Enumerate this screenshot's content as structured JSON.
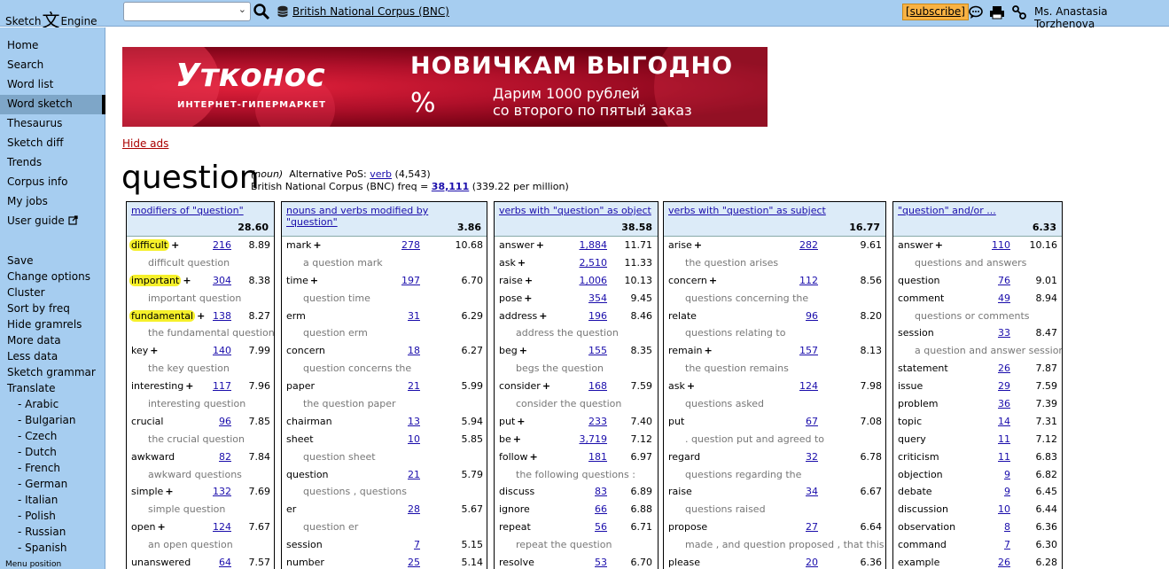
{
  "app": {
    "logo_left": "Sketch",
    "logo_glyph": "文",
    "logo_right": "Engine"
  },
  "topbar": {
    "search_value": "",
    "corpus": "British National Corpus (BNC)",
    "subscribe": "[subscribe]",
    "user": "Ms. Anastasia Torzhenova"
  },
  "sidebar": {
    "items": [
      "Home",
      "Search",
      "Word list",
      "Word sketch",
      "Thesaurus",
      "Sketch diff",
      "Trends",
      "Corpus info",
      "My jobs",
      "User guide"
    ],
    "actions": [
      "Save",
      "Change options",
      "Cluster",
      "Sort by freq",
      "Hide gramrels",
      "More data",
      "Less data",
      "Sketch grammar",
      "Translate"
    ],
    "languages": [
      "- Arabic",
      "- Bulgarian",
      "- Czech",
      "- Dutch",
      "- French",
      "- German",
      "- Italian",
      "- Polish",
      "- Russian",
      "- Spanish"
    ],
    "footer": "Menu position",
    "active": "Word sketch"
  },
  "ad": {
    "brand": "Утконос",
    "brand_sub": "ИНТЕРНЕТ-ГИПЕРМАРКЕТ",
    "headline": "НОВИЧКАМ ВЫГОДНО",
    "percent": "%",
    "line1": "Дарим 1000 рублей",
    "line2": "со второго по пятый заказ",
    "hide": "Hide ads"
  },
  "headword": {
    "word": "question",
    "pos": "(noun)",
    "alt_pos_label": "Alternative PoS:",
    "alt_pos": "verb",
    "alt_pos_count": "(4,543)",
    "corpus_freq_label": "British National Corpus (BNC) freq =",
    "freq": "38,111",
    "per_million": "(339.22 per million)"
  },
  "tables": [
    {
      "title": "modifiers of \"question\"",
      "score": "28.60",
      "rows": [
        {
          "word": "difficult",
          "plus": true,
          "freq": "216",
          "score": "8.89",
          "hl": true
        },
        {
          "example": "difficult question"
        },
        {
          "word": "important",
          "plus": true,
          "freq": "304",
          "score": "8.38",
          "hl": true
        },
        {
          "example": "important question"
        },
        {
          "word": "fundamental",
          "plus": true,
          "freq": "138",
          "score": "8.27",
          "hl": true
        },
        {
          "example": "the fundamental question"
        },
        {
          "word": "key",
          "plus": true,
          "freq": "140",
          "score": "7.99"
        },
        {
          "example": "the key question"
        },
        {
          "word": "interesting",
          "plus": true,
          "freq": "117",
          "score": "7.96"
        },
        {
          "example": "interesting question"
        },
        {
          "word": "crucial",
          "plus": false,
          "freq": "96",
          "score": "7.85"
        },
        {
          "example": "the crucial question"
        },
        {
          "word": "awkward",
          "plus": false,
          "freq": "82",
          "score": "7.84"
        },
        {
          "example": "awkward questions"
        },
        {
          "word": "simple",
          "plus": true,
          "freq": "132",
          "score": "7.69"
        },
        {
          "example": "simple question"
        },
        {
          "word": "open",
          "plus": true,
          "freq": "124",
          "score": "7.67"
        },
        {
          "example": "an open question"
        },
        {
          "word": "unanswered",
          "plus": false,
          "freq": "64",
          "score": "7.57"
        }
      ]
    },
    {
      "title": "nouns and verbs modified by \"question\"",
      "score": "3.86",
      "rows": [
        {
          "word": "mark",
          "plus": true,
          "freq": "278",
          "score": "10.68"
        },
        {
          "example": "a question mark"
        },
        {
          "word": "time",
          "plus": true,
          "freq": "197",
          "score": "6.70"
        },
        {
          "example": "question time"
        },
        {
          "word": "erm",
          "plus": false,
          "freq": "31",
          "score": "6.29"
        },
        {
          "example": "question erm"
        },
        {
          "word": "concern",
          "plus": false,
          "freq": "18",
          "score": "6.27"
        },
        {
          "example": "question concerns the"
        },
        {
          "word": "paper",
          "plus": false,
          "freq": "21",
          "score": "5.99"
        },
        {
          "example": "the question paper"
        },
        {
          "word": "chairman",
          "plus": false,
          "freq": "13",
          "score": "5.94"
        },
        {
          "word": "sheet",
          "plus": false,
          "freq": "10",
          "score": "5.85"
        },
        {
          "example": "question sheet"
        },
        {
          "word": "question",
          "plus": false,
          "freq": "21",
          "score": "5.79"
        },
        {
          "example": "questions , questions"
        },
        {
          "word": "er",
          "plus": false,
          "freq": "28",
          "score": "5.67"
        },
        {
          "example": "question er"
        },
        {
          "word": "session",
          "plus": false,
          "freq": "7",
          "score": "5.15"
        },
        {
          "word": "number",
          "plus": false,
          "freq": "25",
          "score": "5.14"
        }
      ]
    },
    {
      "title": "verbs with \"question\" as object",
      "score": "38.58",
      "rows": [
        {
          "word": "answer",
          "plus": true,
          "freq": "1,884",
          "score": "11.71"
        },
        {
          "word": "ask",
          "plus": true,
          "freq": "2,510",
          "score": "11.33"
        },
        {
          "word": "raise",
          "plus": true,
          "freq": "1,006",
          "score": "10.13"
        },
        {
          "word": "pose",
          "plus": true,
          "freq": "354",
          "score": "9.45"
        },
        {
          "word": "address",
          "plus": true,
          "freq": "196",
          "score": "8.46"
        },
        {
          "example": "address the question"
        },
        {
          "word": "beg",
          "plus": true,
          "freq": "155",
          "score": "8.35"
        },
        {
          "example": "begs the question"
        },
        {
          "word": "consider",
          "plus": true,
          "freq": "168",
          "score": "7.59"
        },
        {
          "example": "consider the question"
        },
        {
          "word": "put",
          "plus": true,
          "freq": "233",
          "score": "7.40"
        },
        {
          "word": "be",
          "plus": true,
          "freq": "3,719",
          "score": "7.12"
        },
        {
          "word": "follow",
          "plus": true,
          "freq": "181",
          "score": "6.97"
        },
        {
          "example": "the following questions :"
        },
        {
          "word": "discuss",
          "plus": false,
          "freq": "83",
          "score": "6.89"
        },
        {
          "word": "ignore",
          "plus": false,
          "freq": "66",
          "score": "6.88"
        },
        {
          "word": "repeat",
          "plus": false,
          "freq": "56",
          "score": "6.71"
        },
        {
          "example": "repeat the question"
        },
        {
          "word": "resolve",
          "plus": false,
          "freq": "53",
          "score": "6.70"
        }
      ]
    },
    {
      "title": "verbs with \"question\" as subject",
      "score": "16.77",
      "rows": [
        {
          "word": "arise",
          "plus": true,
          "freq": "282",
          "score": "9.61"
        },
        {
          "example": "the question arises"
        },
        {
          "word": "concern",
          "plus": true,
          "freq": "112",
          "score": "8.56"
        },
        {
          "example": "questions concerning the"
        },
        {
          "word": "relate",
          "plus": false,
          "freq": "96",
          "score": "8.20"
        },
        {
          "example": "questions relating to"
        },
        {
          "word": "remain",
          "plus": true,
          "freq": "157",
          "score": "8.13"
        },
        {
          "example": "the question remains"
        },
        {
          "word": "ask",
          "plus": true,
          "freq": "124",
          "score": "7.98"
        },
        {
          "example": "questions asked"
        },
        {
          "word": "put",
          "plus": false,
          "freq": "67",
          "score": "7.08"
        },
        {
          "example": ". question put and agreed to"
        },
        {
          "word": "regard",
          "plus": false,
          "freq": "32",
          "score": "6.78"
        },
        {
          "example": "questions regarding the"
        },
        {
          "word": "raise",
          "plus": false,
          "freq": "34",
          "score": "6.67"
        },
        {
          "example": "questions raised"
        },
        {
          "word": "propose",
          "plus": false,
          "freq": "27",
          "score": "6.64"
        },
        {
          "example": "made , and question proposed , that this"
        },
        {
          "word": "please",
          "plus": false,
          "freq": "20",
          "score": "6.36"
        }
      ]
    },
    {
      "title": "\"question\" and/or ...",
      "score": "6.33",
      "rows": [
        {
          "word": "answer",
          "plus": true,
          "freq": "110",
          "score": "10.16"
        },
        {
          "example": "questions and answers"
        },
        {
          "word": "question",
          "plus": false,
          "freq": "76",
          "score": "9.01"
        },
        {
          "word": "comment",
          "plus": false,
          "freq": "49",
          "score": "8.94"
        },
        {
          "example": "questions or comments"
        },
        {
          "word": "session",
          "plus": false,
          "freq": "33",
          "score": "8.47"
        },
        {
          "example": "a question and answer session"
        },
        {
          "word": "statement",
          "plus": false,
          "freq": "26",
          "score": "7.87"
        },
        {
          "word": "issue",
          "plus": false,
          "freq": "29",
          "score": "7.59"
        },
        {
          "word": "problem",
          "plus": false,
          "freq": "36",
          "score": "7.39"
        },
        {
          "word": "topic",
          "plus": false,
          "freq": "14",
          "score": "7.31"
        },
        {
          "word": "query",
          "plus": false,
          "freq": "11",
          "score": "7.12"
        },
        {
          "word": "criticism",
          "plus": false,
          "freq": "11",
          "score": "6.83"
        },
        {
          "word": "objection",
          "plus": false,
          "freq": "9",
          "score": "6.82"
        },
        {
          "word": "debate",
          "plus": false,
          "freq": "9",
          "score": "6.45"
        },
        {
          "word": "discussion",
          "plus": false,
          "freq": "10",
          "score": "6.44"
        },
        {
          "word": "observation",
          "plus": false,
          "freq": "8",
          "score": "6.36"
        },
        {
          "word": "command",
          "plus": false,
          "freq": "7",
          "score": "6.30"
        },
        {
          "word": "example",
          "plus": false,
          "freq": "26",
          "score": "6.28"
        }
      ]
    }
  ]
}
